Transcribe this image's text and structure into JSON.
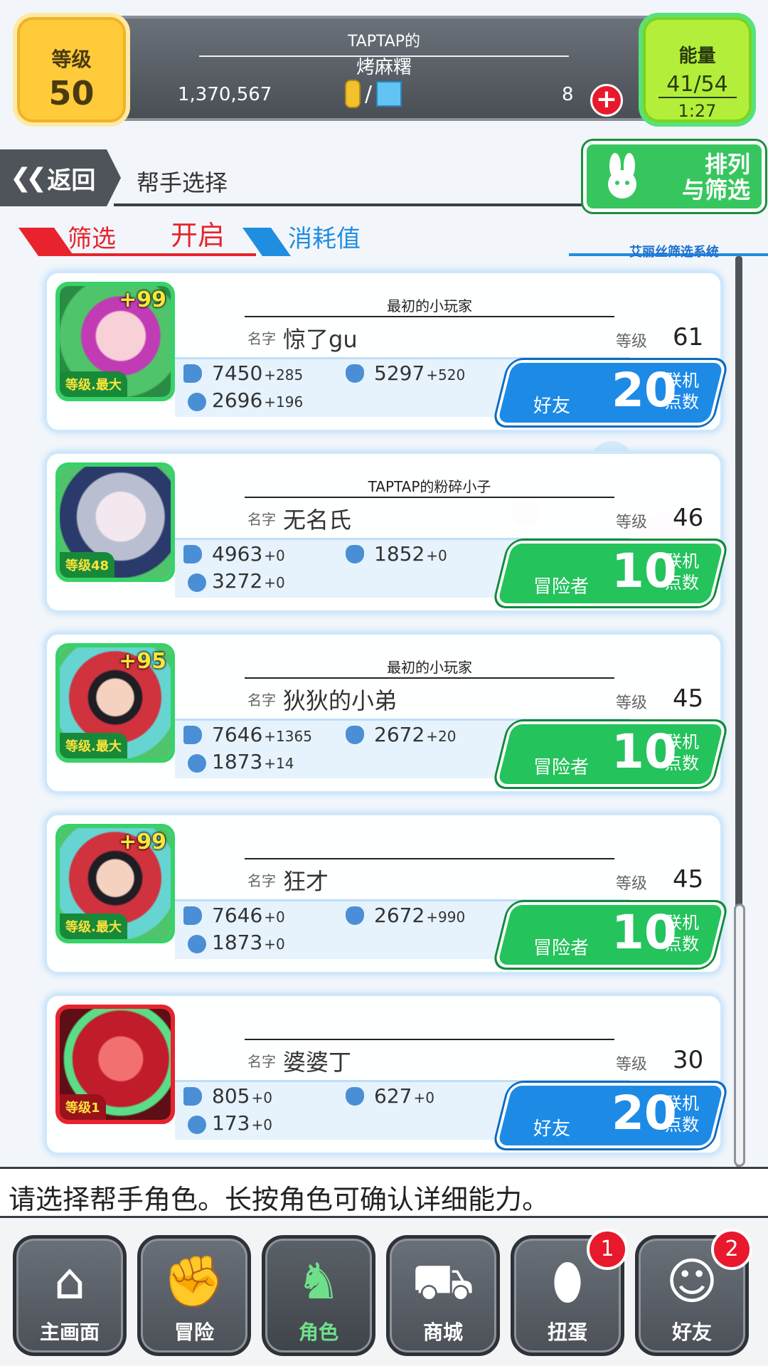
{
  "header": {
    "level_label": "等级",
    "level_value": "50",
    "player_tag": "TAPTAP的",
    "player_name": "烤麻糬",
    "gold": "1,370,567",
    "gems": "8",
    "energy_label": "能量",
    "energy_value": "41/54",
    "energy_timer": "1:27"
  },
  "titlebar": {
    "back_label": "返回",
    "page_title": "帮手选择",
    "sort_label_1": "排列",
    "sort_label_2": "与筛选"
  },
  "filter": {
    "filter_label": "筛选",
    "filter_state": "开启",
    "cost_label": "消耗值",
    "system_label": "艾丽丝筛选系统"
  },
  "helpers": [
    {
      "tag": "最初的小玩家",
      "name_label": "名字",
      "name": "惊了gu",
      "level_label": "等级",
      "level": "61",
      "plus": "+99",
      "avatar_level": "等级.最大",
      "atk": "7450",
      "atk_bonus": "+285",
      "def": "5297",
      "def_bonus": "+520",
      "hp": "2696",
      "hp_bonus": "+196",
      "type": "好友",
      "points": "20",
      "points_label": "联机点数",
      "color": "blue"
    },
    {
      "tag": "TAPTAP的粉碎小子",
      "name_label": "名字",
      "name": "无名氏",
      "level_label": "等级",
      "level": "46",
      "plus": "",
      "avatar_level": "等级48",
      "atk": "4963",
      "atk_bonus": "+0",
      "def": "1852",
      "def_bonus": "+0",
      "hp": "3272",
      "hp_bonus": "+0",
      "type": "冒险者",
      "points": "10",
      "points_label": "联机点数",
      "color": "green"
    },
    {
      "tag": "最初的小玩家",
      "name_label": "名字",
      "name": "狄狄的小弟",
      "level_label": "等级",
      "level": "45",
      "plus": "+95",
      "avatar_level": "等级.最大",
      "atk": "7646",
      "atk_bonus": "+1365",
      "def": "2672",
      "def_bonus": "+20",
      "hp": "1873",
      "hp_bonus": "+14",
      "type": "冒险者",
      "points": "10",
      "points_label": "联机点数",
      "color": "green"
    },
    {
      "tag": "",
      "name_label": "名字",
      "name": "狂才",
      "level_label": "等级",
      "level": "45",
      "plus": "+99",
      "avatar_level": "等级.最大",
      "atk": "7646",
      "atk_bonus": "+0",
      "def": "2672",
      "def_bonus": "+990",
      "hp": "1873",
      "hp_bonus": "+0",
      "type": "冒险者",
      "points": "10",
      "points_label": "联机点数",
      "color": "green"
    },
    {
      "tag": "",
      "name_label": "名字",
      "name": "婆婆丁",
      "level_label": "等级",
      "level": "30",
      "plus": "",
      "avatar_level": "等级1",
      "atk": "805",
      "atk_bonus": "+0",
      "def": "627",
      "def_bonus": "+0",
      "hp": "173",
      "hp_bonus": "+0",
      "type": "好友",
      "points": "20",
      "points_label": "联机点数",
      "color": "blue"
    }
  ],
  "hint": "请选择帮手角色。长按角色可确认详细能力。",
  "nav": [
    {
      "label": "主画面",
      "icon": "home-icon",
      "glyph": "⌂",
      "badge": ""
    },
    {
      "label": "冒险",
      "icon": "handshake-icon",
      "glyph": "✊",
      "badge": ""
    },
    {
      "label": "角色",
      "icon": "bunny-icon",
      "glyph": "♞",
      "badge": "",
      "active": true
    },
    {
      "label": "商城",
      "icon": "cart-icon",
      "glyph": "⛟",
      "badge": ""
    },
    {
      "label": "扭蛋",
      "icon": "egg-icon",
      "glyph": "⬮",
      "badge": "1"
    },
    {
      "label": "好友",
      "icon": "friends-icon",
      "glyph": "☺",
      "badge": "2"
    }
  ],
  "colors": {
    "accent_blue": "#1d8ae6",
    "accent_green": "#24c35c",
    "accent_red": "#e8232d",
    "level_yellow": "#ffcb3b",
    "energy_green": "#b3ef3a"
  }
}
